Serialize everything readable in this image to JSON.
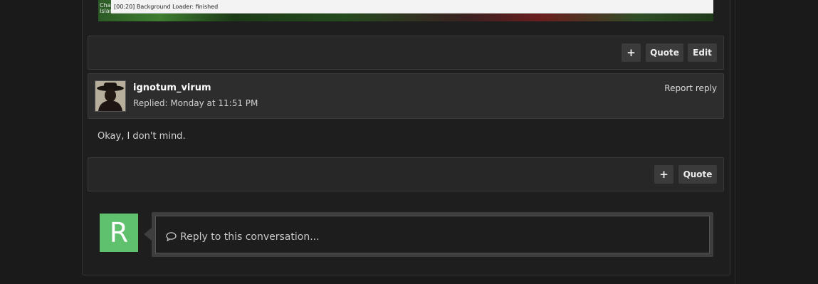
{
  "embedded_image": {
    "loader_text": "[00:20] Background Loader: finished",
    "sliver_lines": [
      "Chat",
      "Islan"
    ]
  },
  "post_actions": {
    "plus_label": "+",
    "quote_label": "Quote",
    "edit_label": "Edit"
  },
  "reply": {
    "username": "ignotum_virum",
    "meta": "Replied: Monday at 11:51 PM",
    "report_label": "Report reply",
    "message": "Okay, I don't mind.",
    "plus_label": "+",
    "quote_label": "Quote"
  },
  "composer": {
    "avatar_letter": "R",
    "avatar_color": "#5fc06e",
    "placeholder": "Reply to this conversation...",
    "icon": "comment-icon"
  }
}
